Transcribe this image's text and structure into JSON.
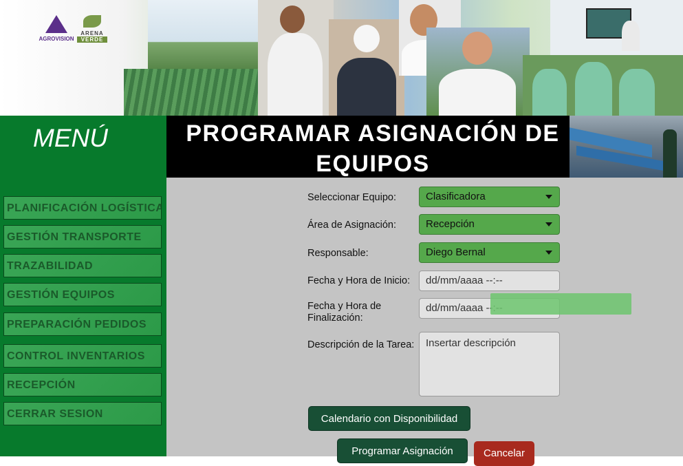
{
  "logos": {
    "agrovision": "AGROVISION",
    "arena_verde_top": "ARENA",
    "arena_verde_bottom": "VERDE"
  },
  "sidebar": {
    "title": "MENÚ",
    "items": [
      {
        "label": "PLANIFICACIÓN LOGÍSTICA"
      },
      {
        "label": "GESTIÓN TRANSPORTE"
      },
      {
        "label": "TRAZABILIDAD"
      },
      {
        "label": "GESTIÓN EQUIPOS"
      },
      {
        "label": "PREPARACIÓN PEDIDOS"
      },
      {
        "label": "CONTROL INVENTARIOS"
      },
      {
        "label": "RECEPCIÓN"
      },
      {
        "label": "CERRAR SESION"
      }
    ]
  },
  "page": {
    "title_line1": "PROGRAMAR  ASIGNACIÓN DE",
    "title_line2": "EQUIPOS"
  },
  "form": {
    "equipo": {
      "label": "Seleccionar Equipo:",
      "value": "Clasificadora"
    },
    "area": {
      "label": "Área de Asignación:",
      "value": "Recepción"
    },
    "responsable": {
      "label": "Responsable:",
      "value": "Diego Bernal"
    },
    "inicio": {
      "label": "Fecha y Hora de Inicio:",
      "value": "dd/mm/aaaa --:--"
    },
    "fin": {
      "label_line1": "Fecha y Hora de",
      "label_line2": "Finalización:",
      "value": "dd/mm/aaaa --:--"
    },
    "descripcion": {
      "label": "Descripción de la Tarea:",
      "placeholder": "Insertar descripción"
    }
  },
  "buttons": {
    "calendar": "Calendario con Disponibilidad",
    "program": "Programar Asignación",
    "cancel": "Cancelar"
  },
  "colors": {
    "sidebar_bg": "#077a2c",
    "select_bg": "#55a84b",
    "main_bg": "#c4c4c4",
    "primary_button": "#184f35",
    "cancel_button": "#a82a1e"
  }
}
